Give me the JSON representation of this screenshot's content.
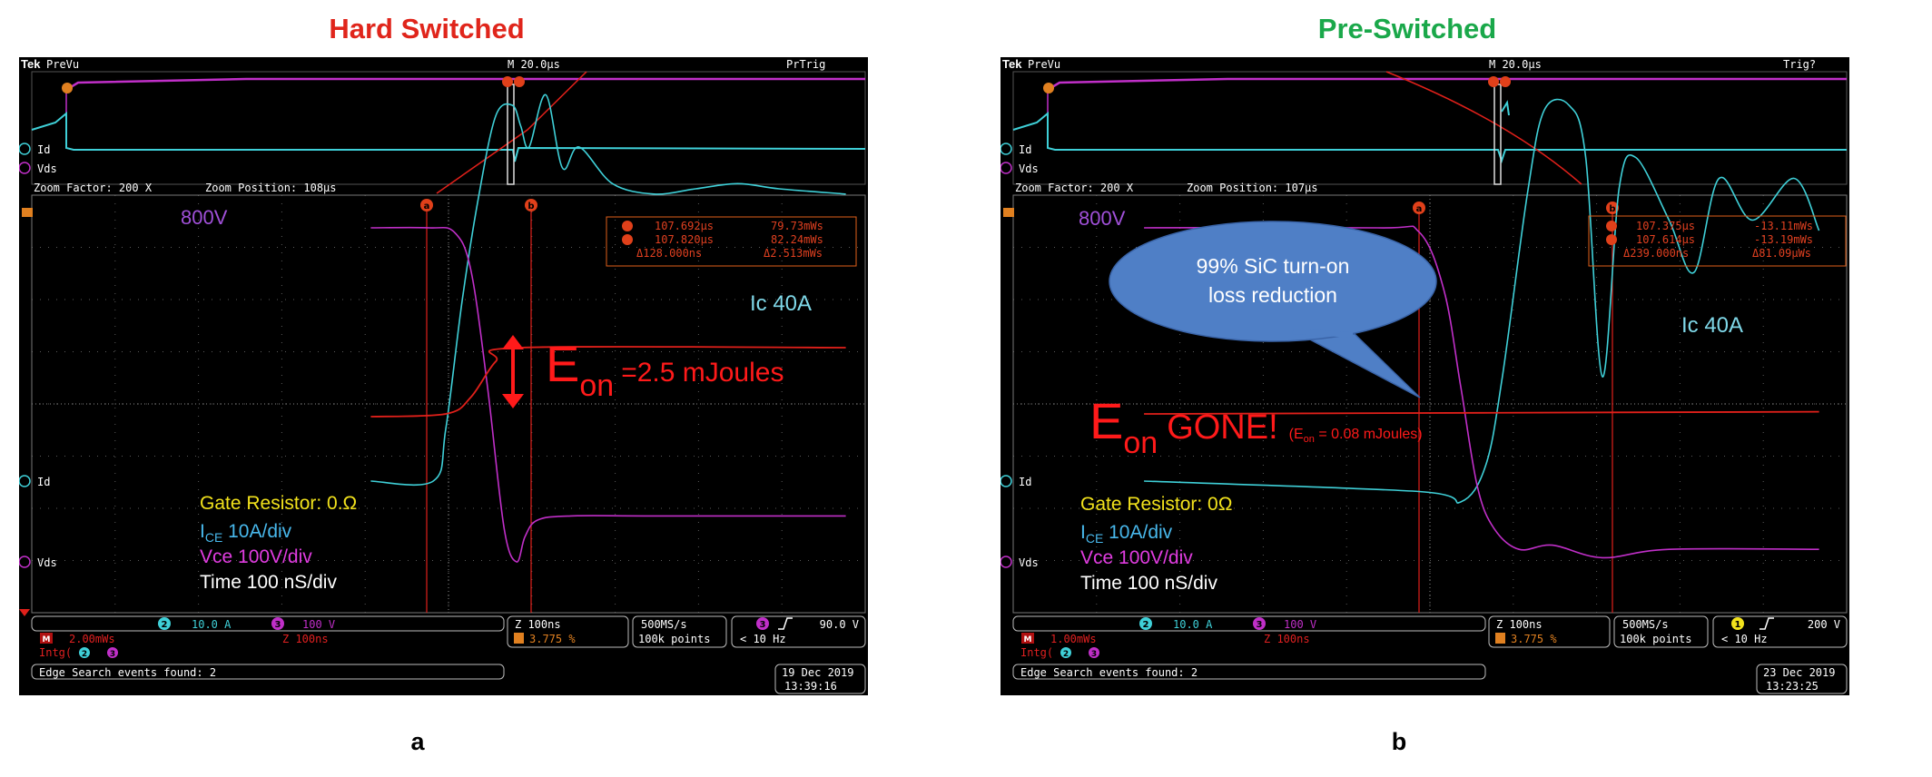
{
  "panels": [
    {
      "id": "a",
      "title": "Hard Switched",
      "title_color": "#e0251b",
      "panel_label": "a",
      "brand": "Tek",
      "mode": "PreVu",
      "timebase": "M 20.0µs",
      "trigger_status": "PrTrig",
      "zoom_factor": "Zoom Factor: 200 X",
      "zoom_position": "Zoom Position: 108µs",
      "ch_id_label": "Id",
      "ch_vds_label": "Vds",
      "voltage_label": "800V",
      "current_label": "Ic 40A",
      "cursor_a": "a",
      "cursor_b": "b",
      "meas": {
        "a_time": "107.692µs",
        "a_val": "79.73mWs",
        "b_time": "107.820µs",
        "b_val": "82.24mWs",
        "d_time": "Δ128.000ns",
        "d_val": "Δ2.513mWs"
      },
      "eon_main": "E",
      "eon_sub": "on",
      "eon_value": "=2.5 mJoules",
      "gate_resistor": "Gate Resistor: 0.Ω",
      "ice_main": "I",
      "ice_sub": "CE",
      "ice_scale": " 10A/div",
      "vce_scale": "Vce 100V/div",
      "time_scale": "Time 100 nS/div",
      "status": {
        "ch2_num": "2",
        "ch2_scale": "10.0 A",
        "ch3_num": "3",
        "ch3_scale": "100 V",
        "math": "M",
        "math_scale": "2.00mWs",
        "math_z": "Z 100ns",
        "intg": "Intg(",
        "intg_a": "2",
        "intg_b": "3",
        "z_time": "Z 100ns",
        "t_pos": "3.775 %",
        "rate": "500MS/s",
        "points": "100k points",
        "trig_ch": "3",
        "trig_level": "90.0 V",
        "trig_freq": "< 10 Hz",
        "edge_search": "Edge Search events found: 2",
        "date": "19 Dec 2019",
        "time": "13:39:16"
      }
    },
    {
      "id": "b",
      "title": "Pre-Switched",
      "title_color": "#1aa84a",
      "panel_label": "b",
      "brand": "Tek",
      "mode": "PreVu",
      "timebase": "M 20.0µs",
      "trigger_status": "Trig?",
      "zoom_factor": "Zoom Factor: 200 X",
      "zoom_position": "Zoom Position: 107µs",
      "ch_id_label": "Id",
      "ch_vds_label": "Vds",
      "voltage_label": "800V",
      "current_label": "Ic 40A",
      "cursor_a": "a",
      "cursor_b": "b",
      "meas": {
        "a_time": "107.375µs",
        "a_val": "-13.11mWs",
        "b_time": "107.614µs",
        "b_val": "-13.19mWs",
        "d_time": "Δ239.000ns",
        "d_val": "Δ81.09µWs"
      },
      "callout_line1": "99% SiC turn-on",
      "callout_line2": "loss reduction",
      "eon_main": "E",
      "eon_sub": "on",
      "eon_gone": "GONE!",
      "eon_small_prefix": "(E",
      "eon_small_sub": "on",
      "eon_small_value": " = 0.08 mJoules)",
      "gate_resistor": "Gate Resistor: 0Ω",
      "ice_main": "I",
      "ice_sub": "CE",
      "ice_scale": " 10A/div",
      "vce_scale": "Vce 100V/div",
      "time_scale": "Time 100 nS/div",
      "status": {
        "ch2_num": "2",
        "ch2_scale": "10.0 A",
        "ch3_num": "3",
        "ch3_scale": "100 V",
        "math": "M",
        "math_scale": "1.00mWs",
        "math_z": "Z 100ns",
        "intg": "Intg(",
        "intg_a": "2",
        "intg_b": "3",
        "z_time": "Z 100ns",
        "t_pos": "3.775 %",
        "rate": "500MS/s",
        "points": "100k points",
        "trig_ch": "1",
        "trig_level": "200 V",
        "trig_freq": "< 10 Hz",
        "edge_search": "Edge Search events found: 2",
        "date": "23 Dec 2019",
        "time": "13:23:25"
      }
    }
  ],
  "colors": {
    "current_trace": "#3fd0d8",
    "voltage_trace": "#c02fc8",
    "energy_trace": "#e0201a",
    "label_voltage": "#a050d8",
    "label_current": "#7fd8e8",
    "gate_text": "#f2e21c",
    "ice_text": "#48b8ec",
    "vce_text": "#e03ce0",
    "eon_text": "#ff1a1a",
    "callout_fill": "#4f7fc6",
    "grid": "#6a6a6a"
  },
  "chart_data": [
    {
      "type": "line",
      "title": "Hard Switched",
      "xlabel": "Time 100 nS/div",
      "ylabel": "",
      "series": [
        {
          "name": "Ic 40A",
          "unit": "A",
          "points": [
            [
              -0.9,
              0
            ],
            [
              -0.15,
              0
            ],
            [
              0.0,
              10
            ],
            [
              0.2,
              35
            ],
            [
              0.4,
              55
            ],
            [
              0.6,
              70
            ],
            [
              0.8,
              72
            ],
            [
              0.9,
              68
            ],
            [
              1.0,
              64
            ],
            [
              1.2,
              74
            ],
            [
              1.4,
              60
            ],
            [
              1.6,
              64
            ],
            [
              2.0,
              57
            ],
            [
              2.5,
              55
            ],
            [
              3.0,
              56
            ],
            [
              3.5,
              57
            ],
            [
              4.0,
              56
            ],
            [
              4.8,
              55
            ]
          ]
        },
        {
          "name": "800V",
          "unit": "V",
          "points": [
            [
              -0.9,
              800
            ],
            [
              -0.2,
              800
            ],
            [
              0.1,
              790
            ],
            [
              0.3,
              700
            ],
            [
              0.5,
              420
            ],
            [
              0.7,
              80
            ],
            [
              0.85,
              0
            ],
            [
              0.95,
              60
            ],
            [
              1.1,
              100
            ],
            [
              1.5,
              110
            ],
            [
              2.5,
              110
            ],
            [
              4.8,
              110
            ]
          ]
        },
        {
          "name": "Eon",
          "unit": "mJ",
          "points": [
            [
              -0.9,
              0
            ],
            [
              0.0,
              0.1
            ],
            [
              0.3,
              0.7
            ],
            [
              0.6,
              2.0
            ],
            [
              0.9,
              2.5
            ],
            [
              4.8,
              2.5
            ]
          ]
        }
      ],
      "annotations": [
        "Eon =2.5 mJoules"
      ]
    },
    {
      "type": "line",
      "title": "Pre-Switched",
      "xlabel": "Time 100 nS/div",
      "ylabel": "",
      "series": [
        {
          "name": "Ic 40A",
          "unit": "A",
          "points": [
            [
              -3.3,
              0
            ],
            [
              0.0,
              -2
            ],
            [
              0.5,
              -4
            ],
            [
              0.8,
              3
            ],
            [
              1.0,
              20
            ],
            [
              1.3,
              55
            ],
            [
              1.5,
              71
            ],
            [
              1.8,
              72
            ],
            [
              2.0,
              62
            ],
            [
              2.2,
              20
            ],
            [
              2.4,
              56
            ],
            [
              2.6,
              62
            ],
            [
              3.0,
              50
            ],
            [
              3.3,
              40
            ],
            [
              3.6,
              58
            ],
            [
              4.0,
              50
            ],
            [
              4.5,
              58
            ],
            [
              4.8,
              48
            ]
          ]
        },
        {
          "name": "800V",
          "unit": "V",
          "points": [
            [
              -3.3,
              800
            ],
            [
              -0.5,
              800
            ],
            [
              0.0,
              790
            ],
            [
              0.3,
              650
            ],
            [
              0.5,
              420
            ],
            [
              0.7,
              180
            ],
            [
              0.9,
              80
            ],
            [
              1.2,
              30
            ],
            [
              1.6,
              40
            ],
            [
              2.2,
              10
            ],
            [
              3.0,
              30
            ],
            [
              4.8,
              30
            ]
          ]
        },
        {
          "name": "Eon",
          "unit": "mJ",
          "points": [
            [
              -3.3,
              0
            ],
            [
              4.8,
              0.08
            ]
          ]
        }
      ],
      "annotations": [
        "99% SiC turn-on loss reduction",
        "Eon GONE! (Eon = 0.08 mJoules)"
      ]
    }
  ]
}
